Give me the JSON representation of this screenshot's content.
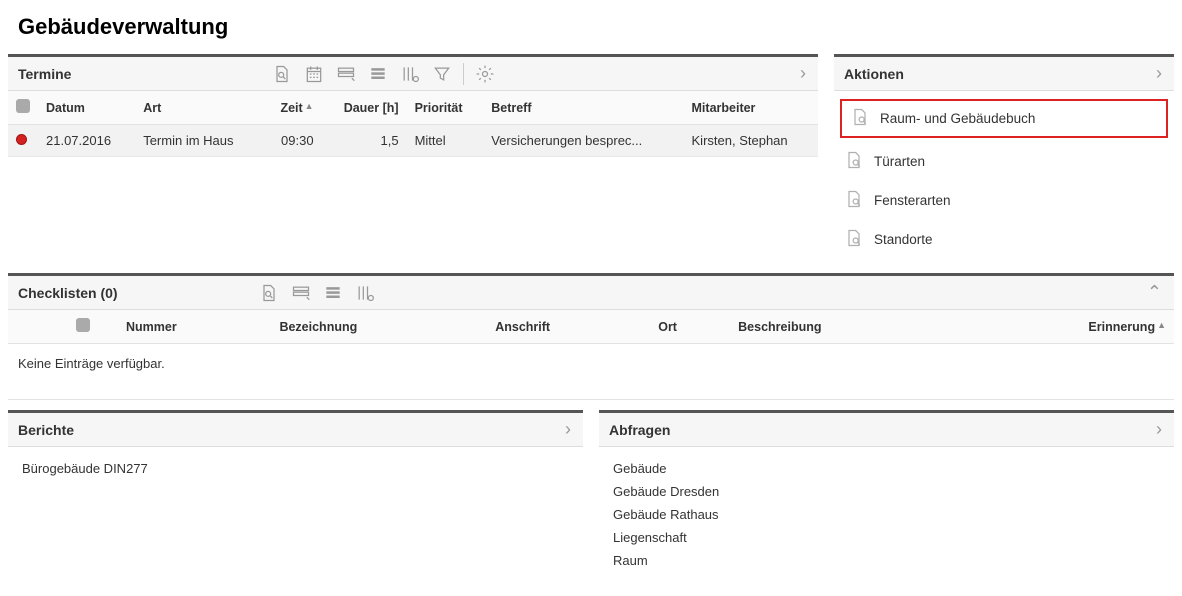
{
  "page": {
    "title": "Gebäudeverwaltung"
  },
  "termine": {
    "title": "Termine",
    "columns": {
      "datum": "Datum",
      "art": "Art",
      "zeit": "Zeit",
      "dauer": "Dauer [h]",
      "prioritaet": "Priorität",
      "betreff": "Betreff",
      "mitarbeiter": "Mitarbeiter"
    },
    "rows": [
      {
        "status": "red",
        "datum": "21.07.2016",
        "art": "Termin im Haus",
        "zeit": "09:30",
        "dauer": "1,5",
        "prioritaet": "Mittel",
        "betreff": "Versicherungen besprec...",
        "mitarbeiter": "Kirsten, Stephan"
      }
    ]
  },
  "aktionen": {
    "title": "Aktionen",
    "items": [
      {
        "label": "Raum- und Gebäudebuch",
        "highlight": true
      },
      {
        "label": "Türarten"
      },
      {
        "label": "Fensterarten"
      },
      {
        "label": "Standorte"
      }
    ]
  },
  "checklisten": {
    "title": "Checklisten (0)",
    "columns": {
      "nummer": "Nummer",
      "bezeichnung": "Bezeichnung",
      "anschrift": "Anschrift",
      "ort": "Ort",
      "beschreibung": "Beschreibung",
      "erinnerung": "Erinnerung"
    },
    "empty_message": "Keine Einträge verfügbar."
  },
  "berichte": {
    "title": "Berichte",
    "items": [
      "Bürogebäude DIN277"
    ]
  },
  "abfragen": {
    "title": "Abfragen",
    "items": [
      "Gebäude",
      "Gebäude Dresden",
      "Gebäude Rathaus",
      "Liegenschaft",
      "Raum"
    ]
  }
}
